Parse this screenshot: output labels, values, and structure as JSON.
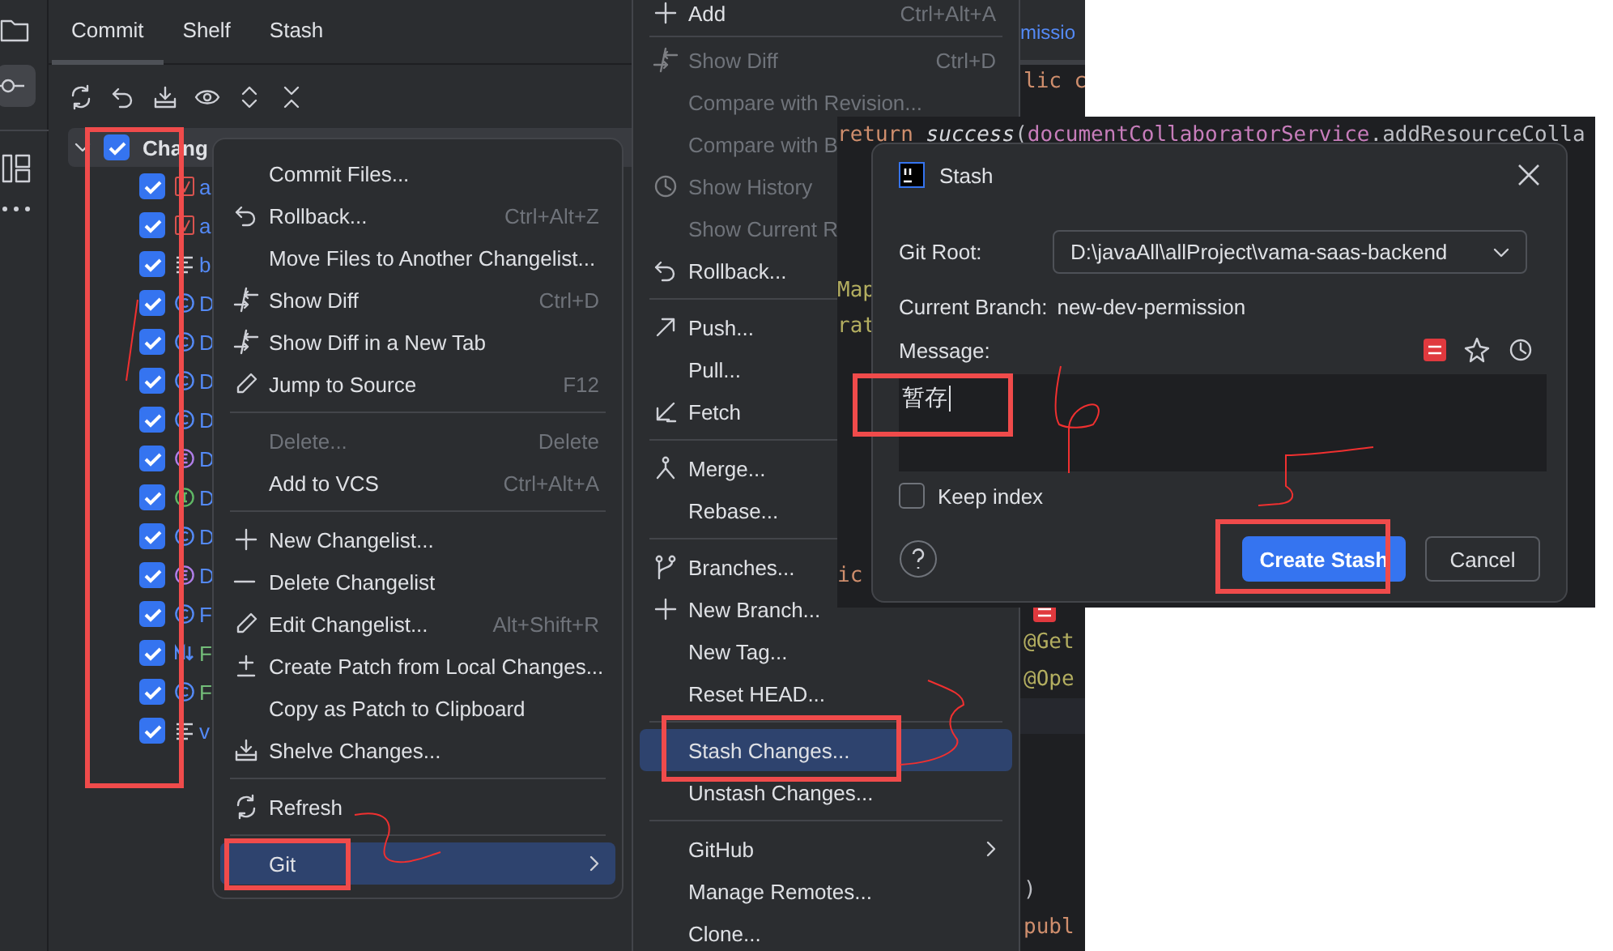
{
  "commit_panel": {
    "tabs": [
      {
        "label": "Commit",
        "selected": true
      },
      {
        "label": "Shelf",
        "selected": false
      },
      {
        "label": "Stash",
        "selected": false
      }
    ],
    "changelist": {
      "label": "Chang",
      "checked": true,
      "expanded": true,
      "files": [
        {
          "label": "a",
          "checked": true,
          "kind": "config",
          "color": "#548af7"
        },
        {
          "label": "a",
          "checked": true,
          "kind": "config",
          "color": "#548af7"
        },
        {
          "label": "b",
          "checked": true,
          "kind": "text",
          "color": "#548af7"
        },
        {
          "label": "D",
          "checked": true,
          "kind": "class",
          "color": "#548af7"
        },
        {
          "label": "D",
          "checked": true,
          "kind": "class",
          "color": "#548af7"
        },
        {
          "label": "D",
          "checked": true,
          "kind": "class",
          "color": "#548af7"
        },
        {
          "label": "D",
          "checked": true,
          "kind": "class",
          "color": "#548af7"
        },
        {
          "label": "D",
          "checked": true,
          "kind": "enum",
          "color": "#548af7"
        },
        {
          "label": "D",
          "checked": true,
          "kind": "interface",
          "color": "#548af7"
        },
        {
          "label": "D",
          "checked": true,
          "kind": "class",
          "color": "#548af7"
        },
        {
          "label": "D",
          "checked": true,
          "kind": "enum",
          "color": "#548af7"
        },
        {
          "label": "F",
          "checked": true,
          "kind": "class",
          "color": "#548af7"
        },
        {
          "label": "F",
          "checked": true,
          "kind": "markdown",
          "color": "#73bd79"
        },
        {
          "label": "F",
          "checked": true,
          "kind": "class",
          "color": "#73bd79"
        },
        {
          "label": "v",
          "checked": true,
          "kind": "text",
          "color": "#548af7"
        }
      ]
    }
  },
  "context_menu": {
    "items": [
      {
        "kind": "item",
        "label": "Commit Files...",
        "disabled": false,
        "selected": false
      },
      {
        "kind": "item",
        "label": "Rollback...",
        "shortcut": "Ctrl+Alt+Z",
        "disabled": false,
        "selected": false
      },
      {
        "kind": "item",
        "label": "Move Files to Another Changelist...",
        "disabled": false,
        "selected": false
      },
      {
        "kind": "item",
        "label": "Show Diff",
        "shortcut": "Ctrl+D",
        "disabled": false,
        "selected": false
      },
      {
        "kind": "item",
        "label": "Show Diff in a New Tab",
        "disabled": false,
        "selected": false
      },
      {
        "kind": "item",
        "label": "Jump to Source",
        "shortcut": "F12",
        "disabled": false,
        "selected": false
      },
      {
        "kind": "separator"
      },
      {
        "kind": "item",
        "label": "Delete...",
        "shortcut": "Delete",
        "disabled": true,
        "selected": false
      },
      {
        "kind": "item",
        "label": "Add to VCS",
        "shortcut": "Ctrl+Alt+A",
        "disabled": false,
        "selected": false
      },
      {
        "kind": "separator"
      },
      {
        "kind": "item",
        "label": "New Changelist...",
        "disabled": false,
        "selected": false
      },
      {
        "kind": "item",
        "label": "Delete Changelist",
        "disabled": false,
        "selected": false
      },
      {
        "kind": "item",
        "label": "Edit Changelist...",
        "shortcut": "Alt+Shift+R",
        "disabled": false,
        "selected": false
      },
      {
        "kind": "item",
        "label": "Create Patch from Local Changes...",
        "disabled": false,
        "selected": false
      },
      {
        "kind": "item",
        "label": "Copy as Patch to Clipboard",
        "disabled": false,
        "selected": false
      },
      {
        "kind": "item",
        "label": "Shelve Changes...",
        "disabled": false,
        "selected": false
      },
      {
        "kind": "separator"
      },
      {
        "kind": "item",
        "label": "Refresh",
        "disabled": false,
        "selected": false
      },
      {
        "kind": "separator"
      },
      {
        "kind": "submenu",
        "label": "Git",
        "disabled": false,
        "selected": true
      }
    ]
  },
  "git_menu": {
    "items": [
      {
        "kind": "item",
        "label": "Add",
        "shortcut": "Ctrl+Alt+A",
        "disabled": false,
        "selected": false
      },
      {
        "kind": "separator"
      },
      {
        "kind": "item",
        "label": "Show Diff",
        "shortcut": "Ctrl+D",
        "disabled": true,
        "selected": false
      },
      {
        "kind": "item",
        "label": "Compare with Revision...",
        "disabled": true,
        "selected": false
      },
      {
        "kind": "item",
        "label": "Compare with B",
        "disabled": true,
        "selected": false
      },
      {
        "kind": "item",
        "label": "Show History",
        "disabled": true,
        "selected": false
      },
      {
        "kind": "item",
        "label": "Show Current R",
        "disabled": true,
        "selected": false
      },
      {
        "kind": "item",
        "label": "Rollback...",
        "disabled": false,
        "selected": false
      },
      {
        "kind": "separator"
      },
      {
        "kind": "item",
        "label": "Push...",
        "disabled": false,
        "selected": false
      },
      {
        "kind": "item",
        "label": "Pull...",
        "disabled": false,
        "selected": false
      },
      {
        "kind": "item",
        "label": "Fetch",
        "disabled": false,
        "selected": false
      },
      {
        "kind": "separator"
      },
      {
        "kind": "item",
        "label": "Merge...",
        "disabled": false,
        "selected": false
      },
      {
        "kind": "item",
        "label": "Rebase...",
        "disabled": false,
        "selected": false
      },
      {
        "kind": "separator"
      },
      {
        "kind": "item",
        "label": "Branches...",
        "disabled": false,
        "selected": false
      },
      {
        "kind": "item",
        "label": "New Branch...",
        "disabled": false,
        "selected": false
      },
      {
        "kind": "item",
        "label": "New Tag...",
        "disabled": false,
        "selected": false
      },
      {
        "kind": "item",
        "label": "Reset HEAD...",
        "disabled": false,
        "selected": false
      },
      {
        "kind": "separator"
      },
      {
        "kind": "item",
        "label": "Stash Changes...",
        "disabled": false,
        "selected": true
      },
      {
        "kind": "item",
        "label": "Unstash Changes...",
        "disabled": false,
        "selected": false
      },
      {
        "kind": "separator"
      },
      {
        "kind": "submenu",
        "label": "GitHub",
        "disabled": false,
        "selected": false
      },
      {
        "kind": "item",
        "label": "Manage Remotes...",
        "disabled": false,
        "selected": false
      },
      {
        "kind": "item",
        "label": "Clone...",
        "disabled": false,
        "selected": false
      }
    ]
  },
  "editor_strip": {
    "tab_label": "missio",
    "lines": [
      {
        "tokens": [
          {
            "text": "lic c",
            "kind": "keyword"
          }
        ]
      },
      {
        "tokens": [
          {
            "text": "@Get",
            "kind": "annotation"
          }
        ]
      },
      {
        "tokens": [
          {
            "text": "@Ope",
            "kind": "annotation"
          }
        ]
      },
      {
        "tokens": [
          {
            "text": ")",
            "kind": "plain"
          }
        ]
      },
      {
        "tokens": [
          {
            "text": "publ",
            "kind": "keyword"
          }
        ]
      }
    ]
  },
  "code_pane": {
    "lines": [
      {
        "tokens": [
          {
            "text": "return ",
            "kind": "keyword"
          },
          {
            "text": "success",
            "kind": "method"
          },
          {
            "text": "(",
            "kind": "plain"
          },
          {
            "text": "documentCollaboratorService",
            "kind": "field"
          },
          {
            "text": ".addResourceColla",
            "kind": "plain"
          }
        ]
      },
      {
        "tokens": [
          {
            "text": "Map",
            "kind": "annotation"
          }
        ]
      },
      {
        "tokens": [
          {
            "text": "rat",
            "kind": "annotation"
          }
        ]
      },
      {
        "tokens": [
          {
            "text": "ic",
            "kind": "keyword"
          }
        ]
      }
    ]
  },
  "stash_dialog": {
    "title": "Stash",
    "git_root_label": "Git Root:",
    "git_root_value": "D:\\javaAll\\allProject\\vama-saas-backend",
    "branch_label": "Current Branch:",
    "branch_value": "new-dev-permission",
    "message_label": "Message:",
    "message_value": "暂存",
    "keep_index": {
      "label": "Keep index",
      "checked": false
    },
    "buttons": [
      {
        "label": "Create Stash",
        "kind": "primary"
      },
      {
        "label": "Cancel",
        "kind": "secondary"
      }
    ]
  }
}
